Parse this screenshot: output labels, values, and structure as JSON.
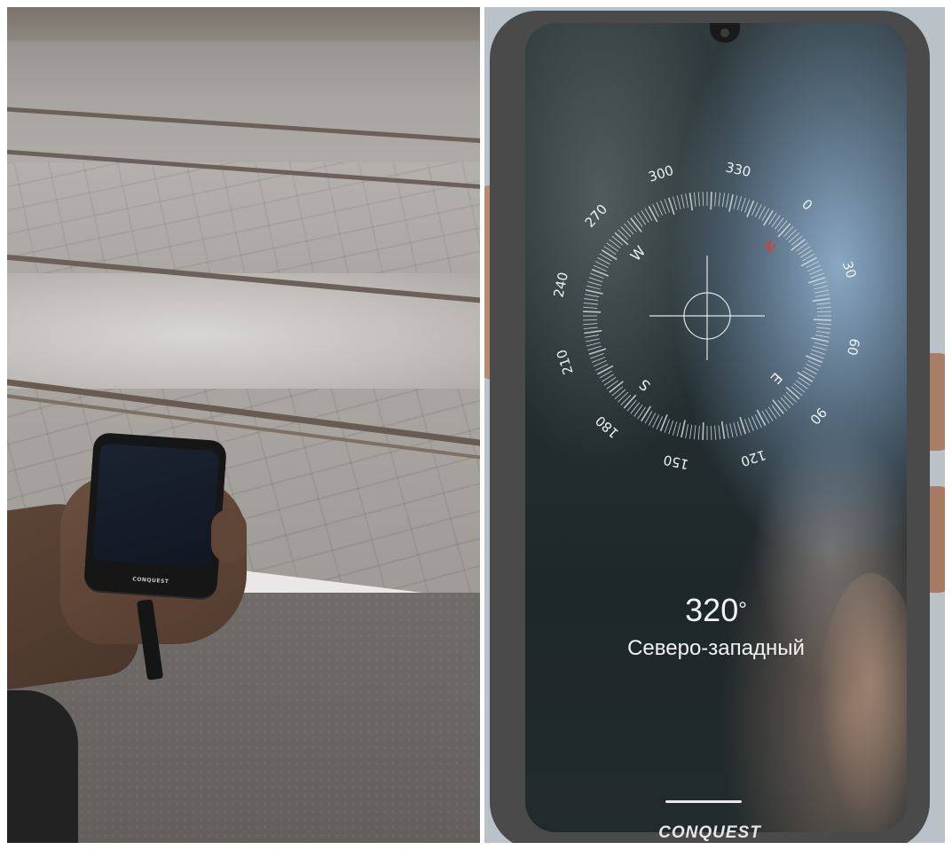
{
  "left_photo": {
    "small_phone_brand": "CONQUEST"
  },
  "right_photo": {
    "compass": {
      "degree_labels": [
        "0",
        "30",
        "60",
        "90",
        "120",
        "150",
        "180",
        "210",
        "240",
        "270",
        "300",
        "330"
      ],
      "cardinal_labels": [
        "N",
        "E",
        "S",
        "W"
      ],
      "north_color": "#e03a2f"
    },
    "heading": {
      "degrees": "320",
      "degree_sign": "°",
      "direction": "Северо-западный"
    },
    "phone_brand": "CONQUEST"
  }
}
